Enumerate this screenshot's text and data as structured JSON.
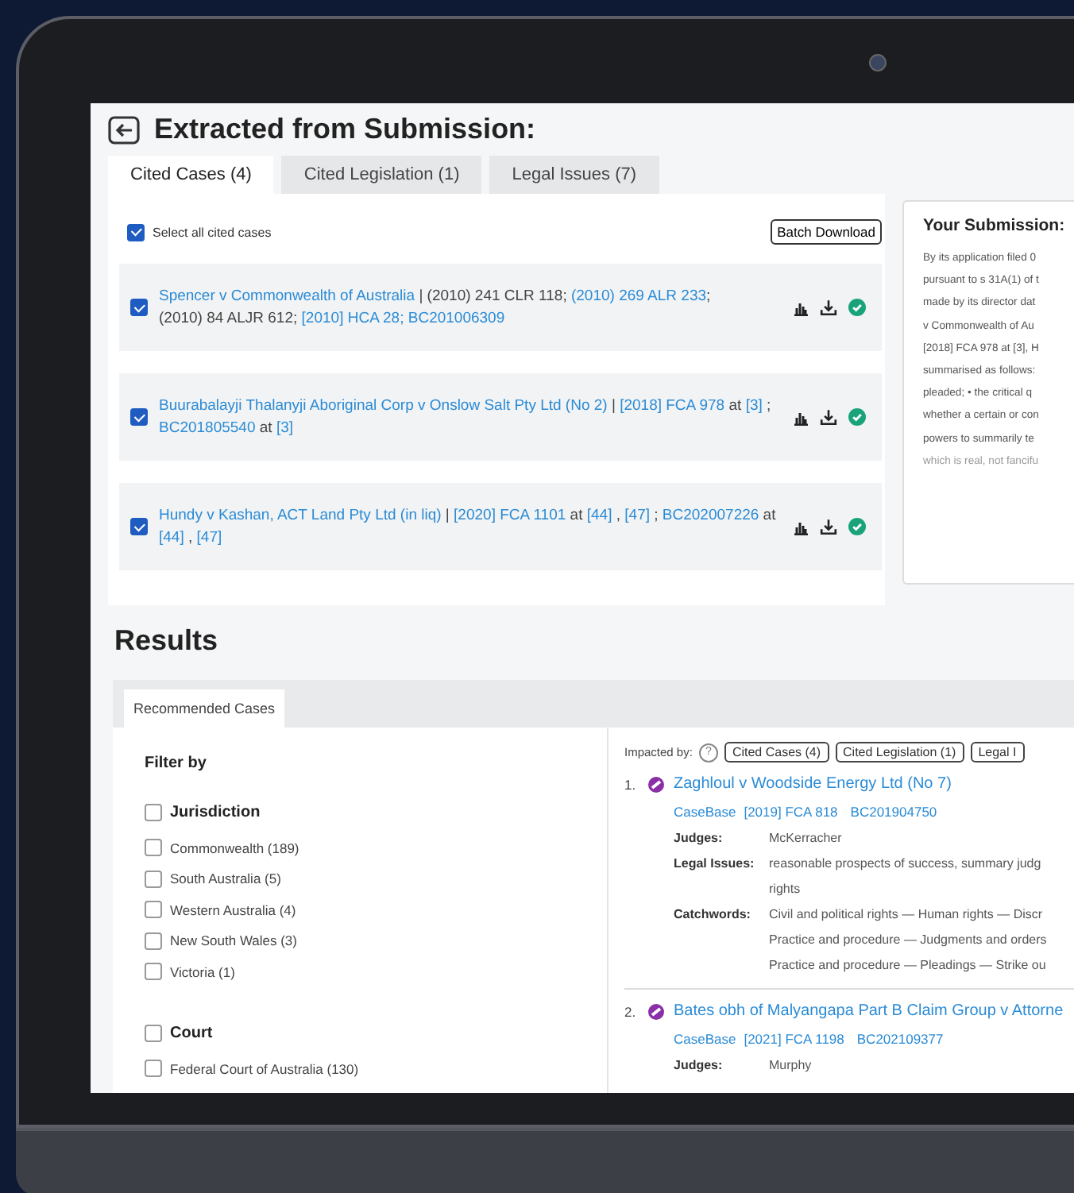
{
  "header": {
    "title": "Extracted from Submission:"
  },
  "tabs": [
    {
      "label": "Cited Cases (4)",
      "selected": true
    },
    {
      "label": "Cited Legislation (1)",
      "selected": false
    },
    {
      "label": "Legal Issues (7)",
      "selected": false
    }
  ],
  "select_all": {
    "label": "Select all cited cases",
    "checked": true
  },
  "batch_download": "Batch Download",
  "cited_cases": [
    {
      "checked": true,
      "parts": [
        {
          "text": "Spencer v Commonwealth of Australia",
          "link": true
        },
        {
          "text": " | (2010) 241 CLR 118; ",
          "link": false
        },
        {
          "text": "(2010) 269 ALR 233",
          "link": true
        },
        {
          "text": ";",
          "link": false
        },
        {
          "text": " (2010) 84 ALJR 612; ",
          "link": false
        },
        {
          "text": "[2010] HCA 28; BC201006309",
          "link": true
        }
      ]
    },
    {
      "checked": true,
      "parts": [
        {
          "text": "Buurabalayji Thalanyji Aboriginal Corp v Onslow Salt Pty Ltd (No 2)",
          "link": true
        },
        {
          "text": " | ",
          "link": false
        },
        {
          "text": "[2018] FCA 978",
          "link": true
        },
        {
          "text": " at ",
          "link": false
        },
        {
          "text": "[3]",
          "link": true
        },
        {
          "text": " ; ",
          "link": false
        },
        {
          "text": "BC201805540",
          "link": true
        },
        {
          "text": " at ",
          "link": false
        },
        {
          "text": "[3]",
          "link": true
        }
      ]
    },
    {
      "checked": true,
      "parts": [
        {
          "text": "Hundy v Kashan, ACT Land Pty Ltd (in liq)",
          "link": true
        },
        {
          "text": " | ",
          "link": false
        },
        {
          "text": "[2020] FCA 1101",
          "link": true
        },
        {
          "text": " at ",
          "link": false
        },
        {
          "text": "[44]",
          "link": true
        },
        {
          "text": " , ",
          "link": false
        },
        {
          "text": "[47]",
          "link": true
        },
        {
          "text": " ; ",
          "link": false
        },
        {
          "text": "BC202007226",
          "link": true
        },
        {
          "text": " at ",
          "link": false
        },
        {
          "text": "[44]",
          "link": true
        },
        {
          "text": " , ",
          "link": false
        },
        {
          "text": "[47]",
          "link": true
        }
      ]
    }
  ],
  "submission": {
    "title": "Your Submission:",
    "lines": [
      "By its application filed 0",
      "pursuant to s 31A(1) of t",
      "made by its director dat",
      "v Commonwealth of Au",
      "[2018] FCA 978 at [3], H",
      "summarised as follows:",
      "pleaded; • the critical q",
      "whether a certain or con",
      "powers to summarily te",
      "which is real, not fancifu"
    ]
  },
  "results": {
    "title": "Results",
    "tabs": [
      {
        "label": "Recommended Cases",
        "selected": true
      }
    ],
    "filter": {
      "title": "Filter by",
      "groups": [
        {
          "label": "Jurisdiction",
          "checked": false,
          "options": [
            {
              "label": "Commonwealth (189)",
              "checked": false
            },
            {
              "label": "South Australia (5)",
              "checked": false
            },
            {
              "label": "Western Australia (4)",
              "checked": false
            },
            {
              "label": "New South Wales (3)",
              "checked": false
            },
            {
              "label": "Victoria (1)",
              "checked": false
            }
          ]
        },
        {
          "label": "Court",
          "checked": false,
          "options": [
            {
              "label": "Federal Court of Australia (130)",
              "checked": false
            }
          ]
        }
      ]
    },
    "impacted_by": {
      "label": "Impacted by:",
      "help": "?",
      "chips": [
        "Cited Cases (4)",
        "Cited Legislation (1)",
        "Legal I"
      ]
    },
    "cases": [
      {
        "number": "1.",
        "title": "Zaghloul v Woodside Energy Ltd (No 7)",
        "refs": [
          "CaseBase",
          "[2019] FCA 818",
          "BC201904750"
        ],
        "fields": [
          {
            "label": "Judges:",
            "lines": [
              "McKerracher"
            ]
          },
          {
            "label": "Legal Issues:",
            "lines": [
              "reasonable prospects of success, summary judg",
              "rights"
            ]
          },
          {
            "label": "Catchwords:",
            "lines": [
              "Civil and political rights — Human rights — Discr",
              "Practice and procedure — Judgments and orders",
              "Practice and procedure — Pleadings — Strike ou"
            ]
          }
        ]
      },
      {
        "number": "2.",
        "title": "Bates obh of Malyangapa Part B Claim Group v Attorne",
        "refs": [
          "CaseBase",
          "[2021] FCA 1198",
          "BC202109377"
        ],
        "fields": [
          {
            "label": "Judges:",
            "lines": [
              "Murphy"
            ]
          }
        ]
      }
    ]
  }
}
